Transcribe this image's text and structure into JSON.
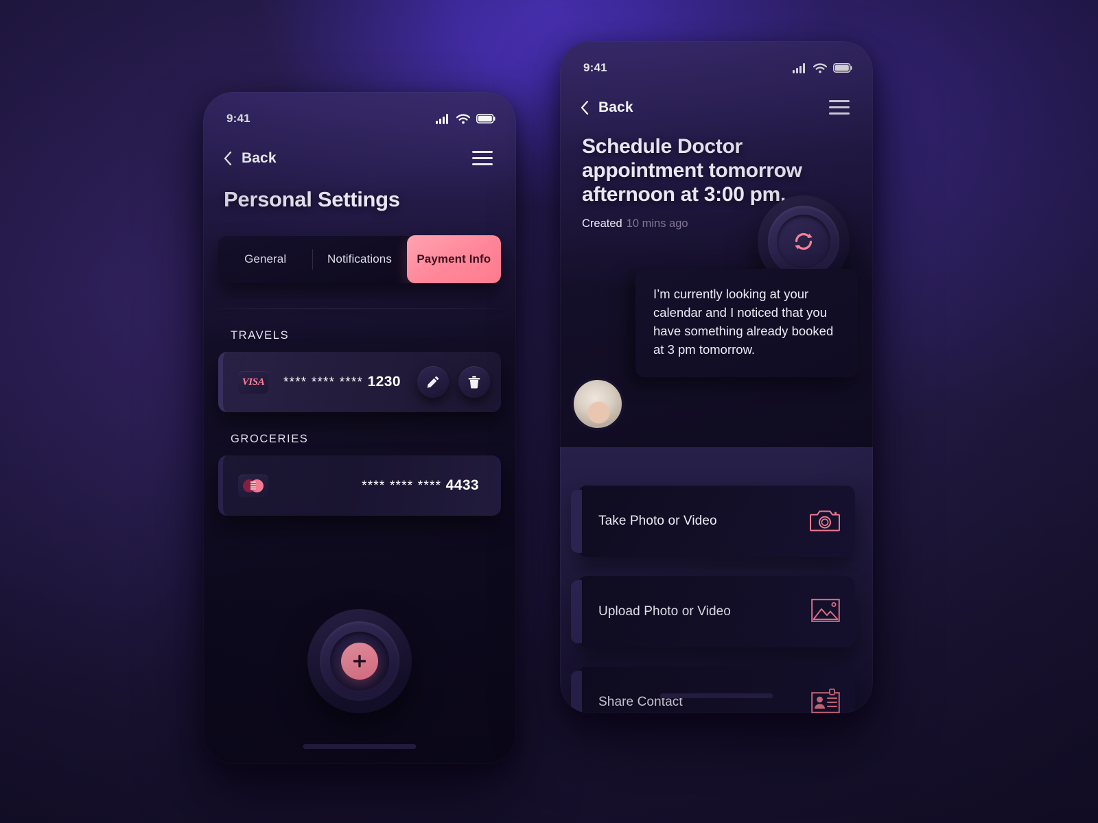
{
  "left_phone": {
    "status": {
      "time": "9:41",
      "signal_icon": "signal-bars-icon",
      "wifi_icon": "wifi-icon",
      "battery_icon": "battery-icon"
    },
    "nav": {
      "back_label": "Back",
      "back_icon": "chevron-left-icon",
      "menu_icon": "hamburger-menu-icon"
    },
    "page_title": "Personal Settings",
    "tabs": [
      {
        "label": "General",
        "active": false
      },
      {
        "label": "Notifications",
        "active": false
      },
      {
        "label": "Payment Info",
        "active": true
      }
    ],
    "sections": [
      {
        "label": "TRAVELS",
        "card": {
          "brand": "VISA",
          "brand_icon": "visa-logo-icon",
          "number": "**** **** **** ",
          "last4": "1230",
          "actions": [
            {
              "name": "edit",
              "icon": "pencil-icon"
            },
            {
              "name": "delete",
              "icon": "trash-icon"
            }
          ]
        }
      },
      {
        "label": "GROCERIES",
        "card": {
          "brand": "Mastercard",
          "brand_icon": "mastercard-logo-icon",
          "number": "**** **** **** ",
          "last4": "4433",
          "actions": []
        }
      }
    ],
    "fab": {
      "icon": "plus-icon",
      "label": "Add payment method"
    }
  },
  "right_phone": {
    "status": {
      "time": "9:41",
      "signal_icon": "signal-bars-icon",
      "wifi_icon": "wifi-icon",
      "battery_icon": "battery-icon"
    },
    "nav": {
      "back_label": "Back",
      "back_icon": "chevron-left-icon",
      "menu_icon": "hamburger-menu-icon"
    },
    "task_title": "Schedule Doctor appointment tomorrow afternoon at 3:00 pm.",
    "created_label": "Created",
    "created_value": "10 mins ago",
    "refresh": {
      "icon": "refresh-sync-icon"
    },
    "message": "I’m currently looking at your calendar and I noticed that you have something already booked at 3 pm tomorrow.",
    "avatar": {
      "name": "user-avatar"
    },
    "sheet_actions": [
      {
        "label": "Take Photo or Video",
        "icon": "camera-icon"
      },
      {
        "label": "Upload Photo or Video",
        "icon": "image-icon"
      },
      {
        "label": "Share Contact",
        "icon": "contact-card-icon"
      }
    ]
  },
  "colors": {
    "accent_pink": "#FF8196",
    "accent_pink_light": "#FFA3B2",
    "backdrop_purple": "#4A31B8",
    "surface_dark": "#100C22",
    "sheet_purple": "#272049"
  }
}
